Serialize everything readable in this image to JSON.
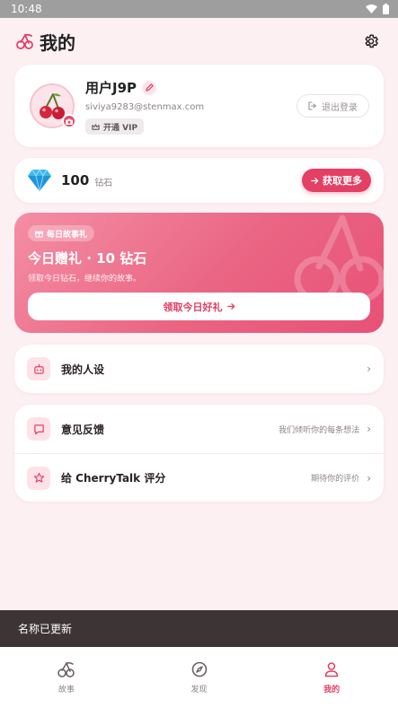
{
  "status_bar": {
    "time": "10:48"
  },
  "header": {
    "title": "我的"
  },
  "profile": {
    "username": "用户J9P",
    "email": "siviya9283@stenmax.com",
    "vip_label": "开通 VIP",
    "logout_label": "退出登录"
  },
  "diamonds": {
    "count": "100",
    "unit": "钻石",
    "get_more_label": "获取更多"
  },
  "gift": {
    "badge": "每日故事礼",
    "title": "今日赠礼 · 10 钻石",
    "subtitle": "领取今日钻石，继续你的故事。",
    "button_label": "领取今日好礼"
  },
  "menu": {
    "persona": {
      "label": "我的人设"
    },
    "feedback": {
      "label": "意见反馈",
      "hint": "我们倾听你的每条想法"
    },
    "rate": {
      "label": "给 CherryTalk 评分",
      "hint": "期待你的评价"
    }
  },
  "toast": {
    "message": "名称已更新"
  },
  "bottom_nav": {
    "items": [
      {
        "label": "故事",
        "icon": "cherry-icon"
      },
      {
        "label": "发现",
        "icon": "compass-icon"
      },
      {
        "label": "我的",
        "icon": "user-icon"
      }
    ]
  },
  "colors": {
    "accent": "#e43f64",
    "background": "#fdf0f3",
    "gift_gradient_start": "#f48ea5",
    "gift_gradient_end": "#e85177"
  }
}
